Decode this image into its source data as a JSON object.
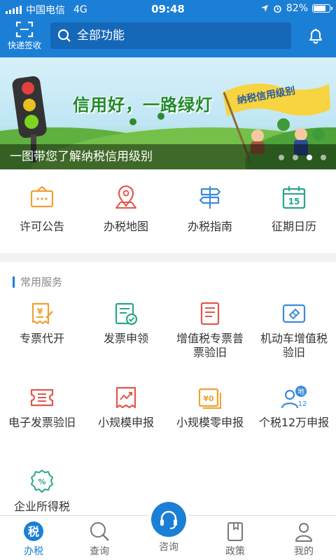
{
  "status_bar": {
    "carrier": "中国电信",
    "network": "4G",
    "time": "09:48",
    "battery": "82%",
    "battery_level": 0.82
  },
  "header": {
    "scan_label": "快递签收",
    "search_placeholder": "全部功能"
  },
  "banner": {
    "slogan": "信用好，一路绿灯",
    "flag_text": "纳税信用级别",
    "caption": "一图带您了解纳税信用级别",
    "slide_count": 4,
    "active_slide": 2
  },
  "quick_items": [
    {
      "label": "许可公告",
      "icon": "announcement-icon"
    },
    {
      "label": "办税地图",
      "icon": "map-pin-icon"
    },
    {
      "label": "办税指南",
      "icon": "signpost-icon"
    },
    {
      "label": "征期日历",
      "icon": "calendar-icon",
      "day": "15"
    }
  ],
  "services": {
    "title": "常用服务",
    "items": [
      {
        "label": "专票代开",
        "icon": "invoice-issue-icon",
        "symbol": "¥"
      },
      {
        "label": "发票申领",
        "icon": "invoice-apply-icon"
      },
      {
        "label": "增值税专票普票验旧",
        "icon": "vat-verify-icon"
      },
      {
        "label": "机动车增值税验旧",
        "icon": "vehicle-invoice-icon"
      },
      {
        "label": "电子发票验旧",
        "icon": "e-invoice-icon"
      },
      {
        "label": "小规模申报",
        "icon": "small-scale-report-icon"
      },
      {
        "label": "小规模零申报",
        "icon": "zero-report-icon",
        "symbol": "¥0"
      },
      {
        "label": "个税12万申报",
        "icon": "income-tax-icon",
        "badge": "地",
        "sub": "12"
      },
      {
        "label": "企业所得税",
        "icon": "corporate-tax-icon",
        "symbol": "%"
      }
    ]
  },
  "tab_bar": {
    "tabs": [
      {
        "label": "办税",
        "icon": "tax-icon",
        "active": true
      },
      {
        "label": "查询",
        "icon": "search-icon"
      },
      {
        "label": "咨询",
        "icon": "headset-icon"
      },
      {
        "label": "政策",
        "icon": "book-icon"
      },
      {
        "label": "我的",
        "icon": "user-icon"
      }
    ]
  },
  "colors": {
    "primary": "#1c7fd6",
    "orange": "#f0a030",
    "red": "#e2574c",
    "teal": "#2aa58a",
    "blue": "#3a8bd8"
  }
}
